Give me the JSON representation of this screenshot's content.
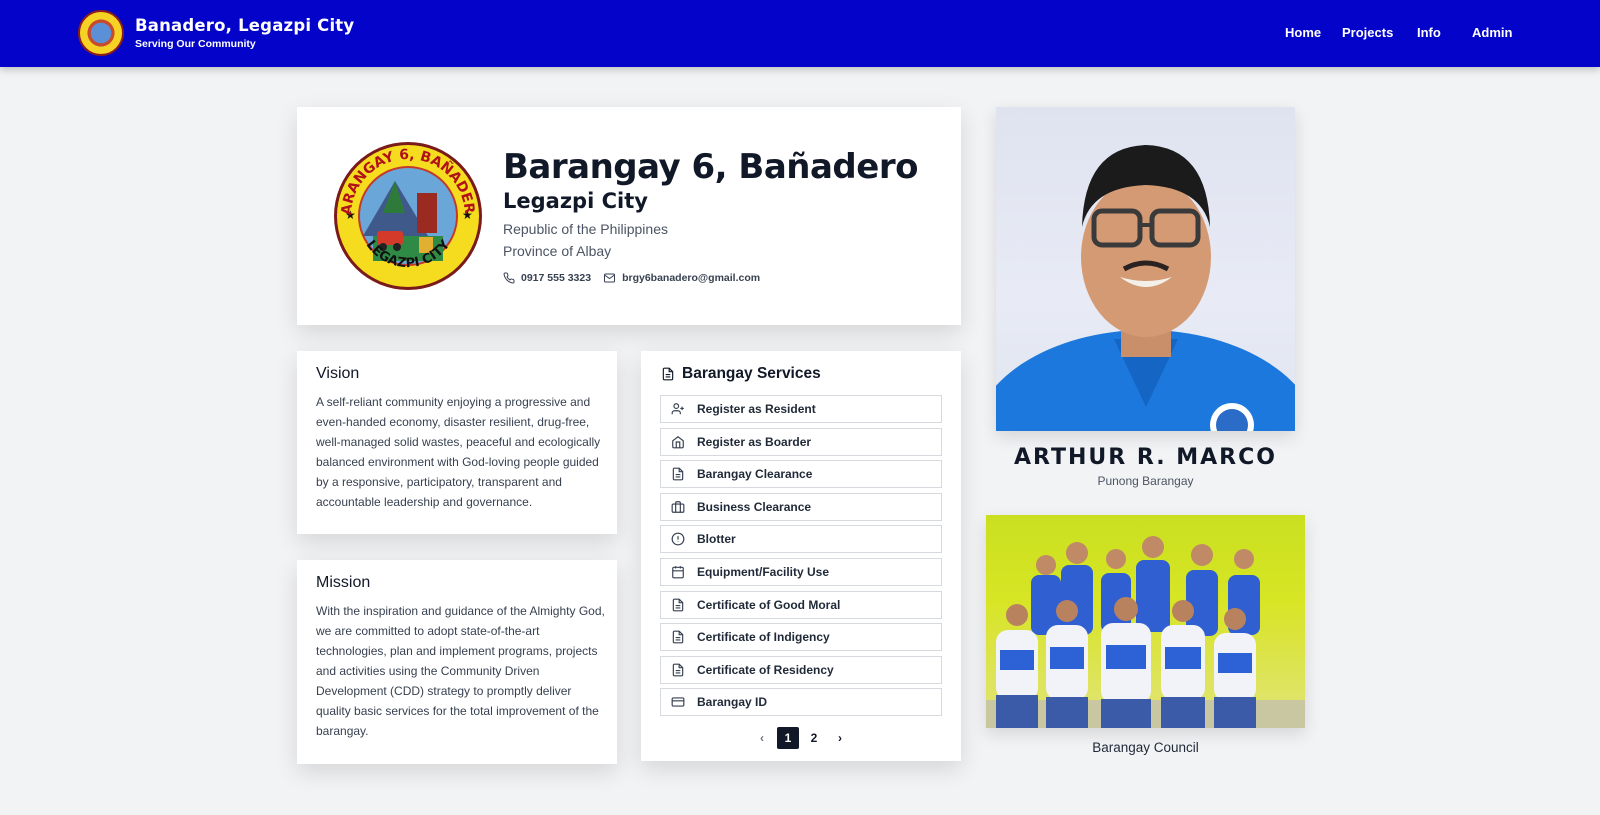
{
  "header": {
    "title": "Banadero, Legazpi City",
    "subtitle": "Serving Our Community",
    "nav": [
      "Home",
      "Projects",
      "Info",
      "Admin"
    ]
  },
  "hero": {
    "seal_text_top": "BARANGAY 6, BAÑADERO",
    "seal_text_bottom": "LEGAZPI CITY",
    "title": "Barangay 6, Bañadero",
    "city": "Legazpi City",
    "line1": "Republic of the Philippines",
    "line2": "Province of Albay",
    "phone": "0917 555 3323",
    "email": "brgy6banadero@gmail.com"
  },
  "vision": {
    "title": "Vision",
    "body": "A self-reliant community enjoying a progressive and even-handed economy, disaster resilient, drug-free, well-managed solid wastes, peaceful and ecologically balanced environment with God-loving people guided by a responsive, participatory, transparent and accountable leadership and governance."
  },
  "mission": {
    "title": "Mission",
    "body": "With the inspiration and guidance of the Almighty God, we are committed to adopt state-of-the-art technologies, plan and implement programs, projects and activities using the Community Driven Development (CDD) strategy to promptly deliver quality basic services for the total improvement of the barangay."
  },
  "services": {
    "title": "Barangay Services",
    "items": [
      {
        "label": "Register as Resident",
        "icon": "user-plus-icon"
      },
      {
        "label": "Register as Boarder",
        "icon": "home-icon"
      },
      {
        "label": "Barangay Clearance",
        "icon": "document-icon"
      },
      {
        "label": "Business Clearance",
        "icon": "briefcase-icon"
      },
      {
        "label": "Blotter",
        "icon": "alert-circle-icon"
      },
      {
        "label": "Equipment/Facility Use",
        "icon": "calendar-icon"
      },
      {
        "label": "Certificate of Good Moral",
        "icon": "document-icon"
      },
      {
        "label": "Certificate of Indigency",
        "icon": "document-icon"
      },
      {
        "label": "Certificate of Residency",
        "icon": "document-icon"
      },
      {
        "label": "Barangay ID",
        "icon": "id-card-icon"
      }
    ],
    "pages": [
      "1",
      "2"
    ],
    "current_page": "1"
  },
  "official": {
    "name": "ARTHUR R. MARCO",
    "role": "Punong Barangay"
  },
  "council": {
    "caption": "Barangay Council"
  },
  "colors": {
    "header": "#0303c9",
    "shirt": "#1a73d9"
  }
}
